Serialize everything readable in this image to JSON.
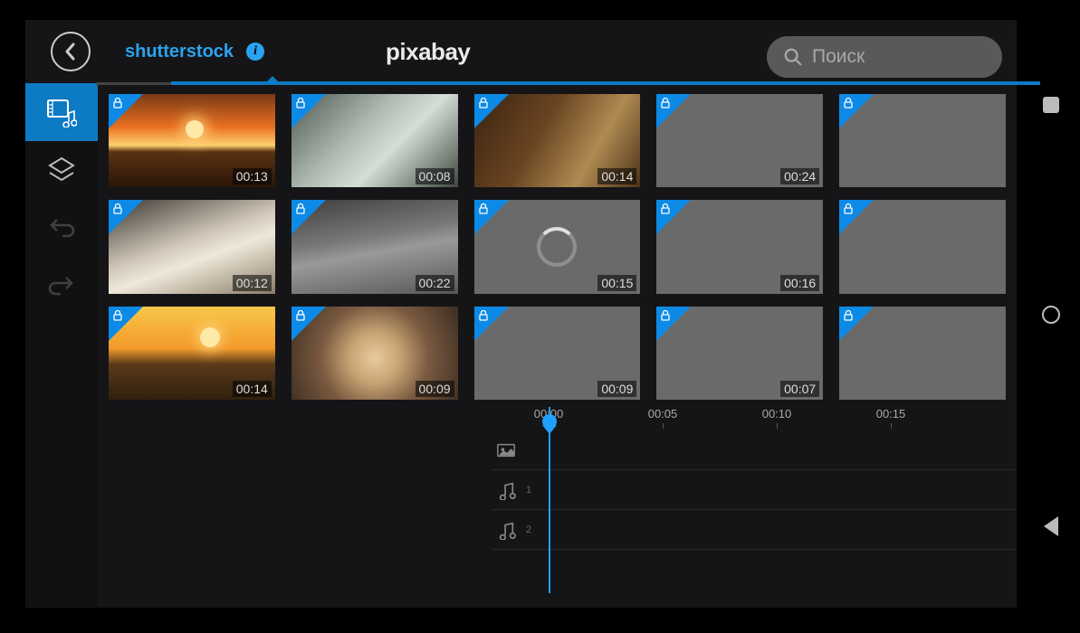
{
  "header": {
    "tabs": {
      "shutterstock": "shutterstock",
      "pixabay": "pixabay"
    },
    "search_placeholder": "Поиск"
  },
  "gallery": {
    "clips": [
      {
        "duration": "00:13",
        "thumb": "sunset"
      },
      {
        "duration": "00:08",
        "thumb": "factory"
      },
      {
        "duration": "00:14",
        "thumb": "robot"
      },
      {
        "duration": "00:24",
        "thumb": "gray"
      },
      {
        "duration": "",
        "thumb": "gray"
      },
      {
        "duration": "00:12",
        "thumb": "typing"
      },
      {
        "duration": "00:22",
        "thumb": "station"
      },
      {
        "duration": "00:15",
        "thumb": "gray",
        "loading": true
      },
      {
        "duration": "00:16",
        "thumb": "gray"
      },
      {
        "duration": "",
        "thumb": "gray"
      },
      {
        "duration": "00:14",
        "thumb": "safari"
      },
      {
        "duration": "00:09",
        "thumb": "phone"
      },
      {
        "duration": "00:09",
        "thumb": "gray"
      },
      {
        "duration": "00:07",
        "thumb": "gray"
      },
      {
        "duration": "",
        "thumb": "gray"
      }
    ]
  },
  "timeline": {
    "ticks": [
      "00:00",
      "00:05",
      "00:10",
      "00:15"
    ],
    "tracks": {
      "video_num": "",
      "audio1_num": "1",
      "audio2_num": "2"
    }
  }
}
